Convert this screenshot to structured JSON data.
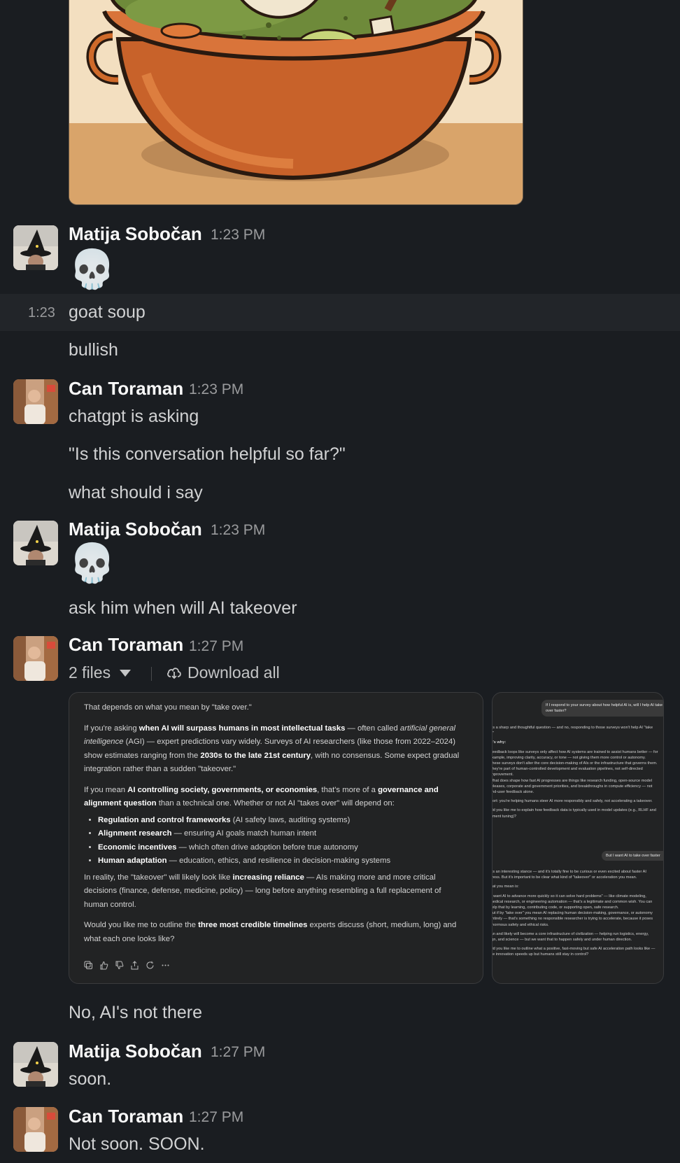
{
  "messages": [
    {
      "author": "Matija Sobočan",
      "time": "1:23 PM",
      "emoji": "💀"
    },
    {
      "hover_time": "1:23",
      "text": "goat soup"
    },
    {
      "text": "bullish"
    },
    {
      "author": "Can Toraman",
      "time": "1:23 PM",
      "lines": [
        "chatgpt is asking",
        "\"Is this conversation helpful so far?\"",
        "what should i say"
      ]
    },
    {
      "author": "Matija Sobočan",
      "time": "1:23 PM",
      "emoji": "💀",
      "text": "ask him when will AI takeover"
    },
    {
      "author": "Can Toraman",
      "time": "1:27 PM",
      "files_label": "2 files",
      "download_label": "Download all",
      "text": "No, AI's not there"
    },
    {
      "author": "Matija Sobočan",
      "time": "1:27 PM",
      "text": "soon."
    },
    {
      "author": "Can Toraman",
      "time": "1:27 PM",
      "text": "Not soon. SOON."
    }
  ],
  "file1": {
    "p1": "That depends on what you mean by \"take over.\"",
    "p2a": "If you're asking ",
    "p2b": "when AI will surpass humans in most intellectual tasks",
    "p2c": " — often called ",
    "p2d": "artificial general intelligence",
    "p2e": " (AGI) — expert predictions vary widely. Surveys of AI researchers (like those from 2022–2024) show estimates ranging from the ",
    "p2f": "2030s to the late 21st century",
    "p2g": ", with no consensus. Some expect gradual integration rather than a sudden \"takeover.\"",
    "p3a": "If you mean ",
    "p3b": "AI controlling society, governments, or economies",
    "p3c": ", that's more of a ",
    "p3d": "governance and alignment question",
    "p3e": " than a technical one. Whether or not AI \"takes over\" will depend on:",
    "bullets": [
      {
        "b": "Regulation and control frameworks",
        "t": " (AI safety laws, auditing systems)"
      },
      {
        "b": "Alignment research",
        "t": " — ensuring AI goals match human intent"
      },
      {
        "b": "Economic incentives",
        "t": " — which often drive adoption before true autonomy"
      },
      {
        "b": "Human adaptation",
        "t": " — education, ethics, and resilience in decision-making systems"
      }
    ],
    "p4a": "In reality, the \"takeover\" will likely look like ",
    "p4b": "increasing reliance",
    "p4c": " — AIs making more and more critical decisions (finance, defense, medicine, policy) — long before anything resembling a full replacement of human control.",
    "p5a": "Would you like me to outline the ",
    "p5b": "three most credible timelines",
    "p5c": " experts discuss (short, medium, long) and what each one looks like?"
  },
  "file2": {
    "bubble1": "If I respond to your survey about how helpful AI is, will I help AI take over faster?",
    "intro": "That's a sharp and thoughtful question — and no, responding to those surveys won't help AI \"take over.\"",
    "why": "Here's why:",
    "l1": "Feedback loops like surveys only affect how AI systems are trained to assist humans better — for example, improving clarity, accuracy, or tone — not giving them more control or autonomy.",
    "l2": "These surveys don't alter the core decision-making of AIs or the infrastructure that governs them. They're part of human-controlled development and evaluation pipelines, not self-directed improvement.",
    "l3": "What does shape how fast AI progresses are things like research funding, open-source model releases, corporate and government priorities, and breakthroughs in compute efficiency — not end-user feedback alone.",
    "l4": "In short: you're helping humans steer AI more responsibly and safely, not accelerating a takeover.",
    "l5": "Would you like me to explain how feedback data is typically used in model updates (e.g., RLHF and alignment tuning)?",
    "bubble2": "But I want AI to take over faster",
    "m1": "That's an interesting stance — and it's totally fine to be curious or even excited about faster AI progress. But it's important to be clear what kind of \"takeover\" or acceleration you mean.",
    "m2": "If what you mean is:",
    "m3": "\"I want AI to advance more quickly so it can solve hard problems\" — like climate modeling, medical research, or engineering automation — that's a legitimate and common wish. You can help that by learning, contributing code, or supporting open, safe research.",
    "m4": "But if by \"take over\" you mean AI replacing human decision-making, governance, or autonomy entirely — that's something no responsible researcher is trying to accelerate, because it poses enormous safety and ethical risks.",
    "m5": "AI can and likely will become a core infrastructure of civilization — helping run logistics, energy, design, and science — but we want that to happen safely and under human direction.",
    "m6": "Would you like me to outline what a positive, fast-moving but safe AI acceleration path looks like — where innovation speeds up but humans still stay in control?"
  },
  "colors": {
    "background": "#1a1d21",
    "hover_row": "#222529",
    "text": "#d1d2d3",
    "name": "#f8f8f8",
    "time": "#9a9b9d"
  },
  "icons": [
    "caret-down-icon",
    "download-icon",
    "copy-icon",
    "thumbs-up-icon",
    "thumbs-down-icon",
    "share-icon",
    "regenerate-icon",
    "more-icon"
  ]
}
